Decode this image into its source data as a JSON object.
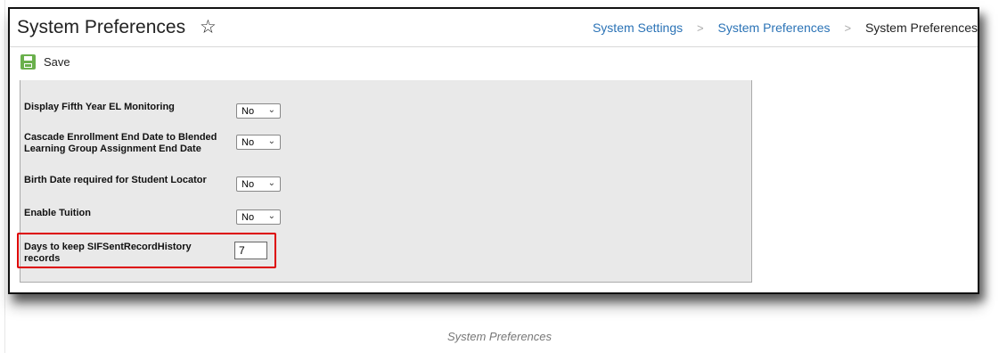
{
  "header": {
    "title": "System Preferences",
    "star_icon": "star-outline-icon",
    "breadcrumbs": [
      "System Settings",
      "System Preferences",
      "System Preferences"
    ]
  },
  "toolbar": {
    "save_label": "Save",
    "save_icon": "floppy-disk-icon"
  },
  "preferences": [
    {
      "label": "Display Fifth Year EL Monitoring",
      "value": "No"
    },
    {
      "label": "Cascade Enrollment End Date to Blended Learning Group Assignment End Date",
      "value": "No"
    },
    {
      "label": "Birth Date required for Student Locator",
      "value": "No"
    },
    {
      "label": "Enable Tuition",
      "value": "No"
    },
    {
      "label": "Days to keep SIFSentRecordHistory records",
      "value": "7"
    }
  ],
  "caption": "System Preferences",
  "colors": {
    "link": "#2b73b6",
    "save_icon": "#6ab04c",
    "panel_bg": "#e9e9e9",
    "highlight": "#dd0000"
  }
}
